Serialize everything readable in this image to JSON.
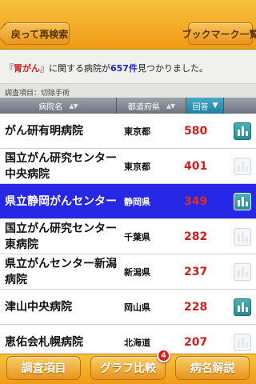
{
  "nav": {
    "back_label": "戻って再検索",
    "bookmark_label": "ブックマーク一覧"
  },
  "result": {
    "open_quote": "『",
    "keyword": "胃がん",
    "mid": "』に関する病院が",
    "count": "657件",
    "suffix": "見つかりました。"
  },
  "survey_item": "調査項目：切除手術",
  "columns": {
    "name": "病院名",
    "prefecture": "都道府県",
    "answer": "回答",
    "sort_icon": "▲▼",
    "answer_sort_icon": "▼"
  },
  "rows": [
    {
      "name": "がん研有明病院",
      "prefecture": "東京都",
      "value": "580",
      "chart": "bar-chart-icon"
    },
    {
      "name": "国立がん研究センター中央病院",
      "prefecture": "東京都",
      "value": "401",
      "chart": "bar-chart-icon"
    },
    {
      "name": "県立静岡がんセンター",
      "prefecture": "静岡県",
      "value": "349",
      "chart": "bar-chart-icon"
    },
    {
      "name": "国立がん研究センター東病院",
      "prefecture": "千葉県",
      "value": "282",
      "chart": "bar-chart-icon"
    },
    {
      "name": "県立がんセンター新潟病院",
      "prefecture": "新潟県",
      "value": "237",
      "chart": "bar-chart-icon"
    },
    {
      "name": "津山中央病院",
      "prefecture": "岡山県",
      "value": "228",
      "chart": "bar-chart-icon"
    },
    {
      "name": "恵佑会札幌病院",
      "prefecture": "北海道",
      "value": "207",
      "chart": "bar-chart-icon"
    }
  ],
  "bottom": {
    "survey_btn": "調査項目",
    "graph_btn": "グラフ比較",
    "graph_badge": "4",
    "disease_btn": "病名解説"
  },
  "colors": {
    "bar_orange": "#f09a17",
    "selected_row": "#2727e6",
    "value_red": "#d41c1c",
    "keyword_red": "#d02424",
    "count_blue": "#2222dd",
    "answer_header": "#1e7fa3"
  }
}
